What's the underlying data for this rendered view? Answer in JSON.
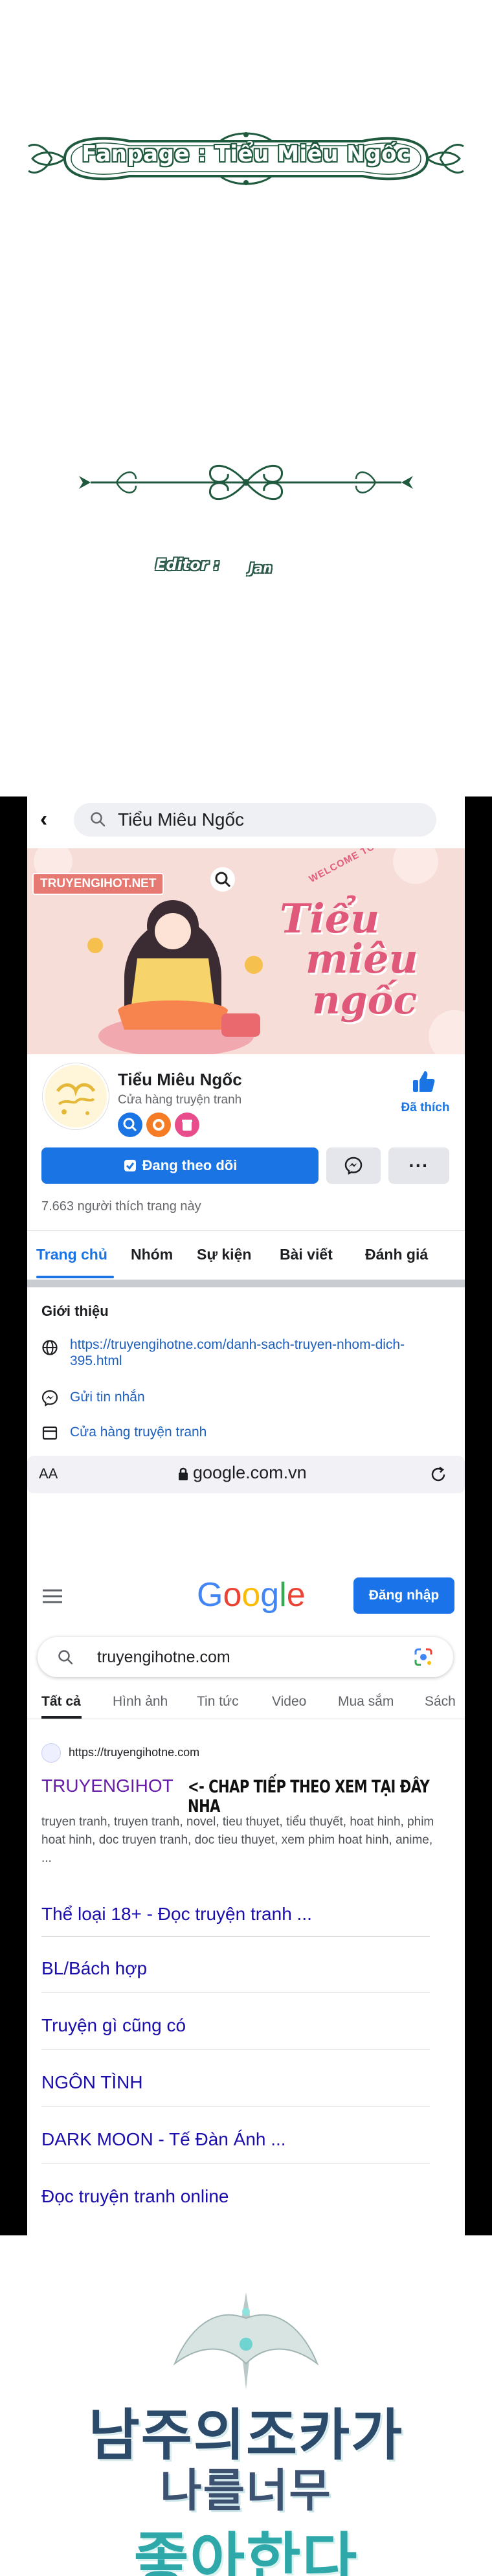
{
  "credits": {
    "fanpage": "Fanpage : Tiểu Miêu Ngốc",
    "editor_label": "Editor :",
    "editor_name": "Jan"
  },
  "facebook": {
    "search_value": "Tiểu Miêu Ngốc",
    "cover": {
      "watermark": "TRUYENGIHOT.NET",
      "welcome": "WELCOME TO",
      "title_line1": "Tiểu",
      "title_line2": "miêu",
      "title_line3": "ngốc"
    },
    "page_name": "Tiểu Miêu Ngốc",
    "category": "Cửa hàng truyện tranh",
    "liked_label": "Đã thích",
    "follow_label": "Đang theo dõi",
    "more_label": "···",
    "likes_count": "7.663 người thích trang này",
    "tabs": [
      "Trang chủ",
      "Nhóm",
      "Sự kiện",
      "Bài viết",
      "Đánh giá"
    ],
    "intro_title": "Giới thiệu",
    "intro_items": [
      {
        "icon": "globe-icon",
        "text": "https://truyengihotne.com/danh-sach-truyen-nhom-dich-395.html"
      },
      {
        "icon": "messenger-icon",
        "text": "Gửi tin nhắn"
      },
      {
        "icon": "shop-icon",
        "text": "Cửa hàng truyện tranh"
      }
    ]
  },
  "safari": {
    "aa": "AA",
    "url": "google.com.vn"
  },
  "google": {
    "logo": "Google",
    "signin_label": "Đăng nhập",
    "query": "truyengihotne.com",
    "tabs": [
      "Tất cả",
      "Hình ảnh",
      "Tin tức",
      "Video",
      "Mua sắm",
      "Sách"
    ],
    "result": {
      "url": "https://truyengihotne.com",
      "title": "TRUYENGIHOT",
      "promo": "<- CHAP TIẾP THEO XEM TẠI ĐÂY NHA",
      "snippet": "truyen tranh, truyen tranh, novel, tieu thuyet, tiểu thuyết, hoat hinh, phim hoat hinh, doc truyen tranh, doc tieu thuyet, xem phim hoat hinh, anime, ..."
    },
    "sitelinks": [
      "Thể loại 18+ - Đọc truyện tranh ...",
      "BL/Bách hợp",
      "Truyện gì cũng có",
      "NGÔN TÌNH",
      "DARK MOON - Tế Đàn Ánh ...",
      "Đọc truyện tranh online"
    ]
  },
  "comic_title": {
    "line1": "남주의조카가",
    "line2": "나를너무",
    "line3": "좋아한다"
  },
  "colors": {
    "facebook_blue": "#1b74e4",
    "google_blue": "#1a73e8",
    "visited_link": "#681da8",
    "link": "#1a0dab",
    "credit_green": "#1f5a3e"
  }
}
